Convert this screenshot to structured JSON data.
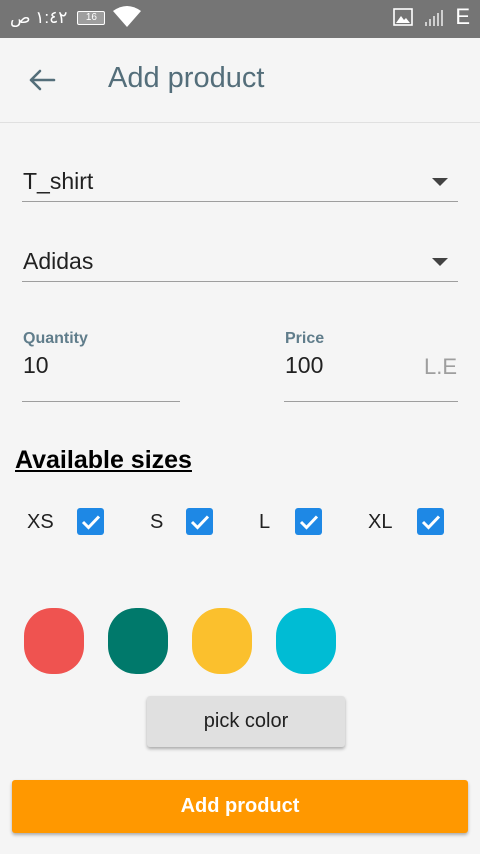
{
  "status_bar": {
    "time": "١:٤٢ ص",
    "battery": "16",
    "network": "E",
    "icons": [
      "wifi-icon",
      "gallery-icon",
      "signal-icon"
    ]
  },
  "app_bar": {
    "title": "Add product",
    "back_icon": "arrow-back-icon"
  },
  "form": {
    "category": {
      "value": "T_shirt"
    },
    "brand": {
      "value": "Adidas"
    },
    "quantity": {
      "label": "Quantity",
      "value": "10"
    },
    "price": {
      "label": "Price",
      "value": "100",
      "suffix": "L.E"
    }
  },
  "sizes": {
    "title": "Available sizes",
    "items": [
      {
        "label": "XS",
        "checked": true
      },
      {
        "label": "S",
        "checked": true
      },
      {
        "label": "L",
        "checked": true
      },
      {
        "label": "XL",
        "checked": true
      }
    ]
  },
  "colors": [
    "#ef5350",
    "#00796b",
    "#fbc02d",
    "#00bcd4"
  ],
  "pick_color_label": "pick color",
  "submit_label": "Add product",
  "accent": "#ff9800",
  "checkbox_color": "#1e88e5"
}
